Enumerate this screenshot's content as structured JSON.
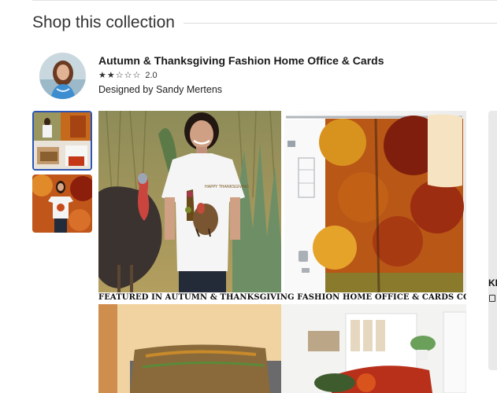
{
  "section": {
    "title": "Shop this collection"
  },
  "collection": {
    "title": "Autumn & Thanksgiving Fashion Home Office & Cards",
    "rating": {
      "stars_filled": 2,
      "stars_total": 5,
      "value": "2.0"
    },
    "designer_line": "Designed by Sandy Mertens"
  },
  "gallery": {
    "selected_index": 0,
    "hero_caption": "FEATURED IN AUTUMN & THANKSGIVING FASHION HOME OFFICE & CARDS COLLECTION",
    "tshirt_print_text": "HAPPY THANKSGIVING"
  },
  "next_card": {
    "label_fragment": "KI"
  },
  "colors": {
    "selected_border": "#2b55b5",
    "divider": "#dcdcdc",
    "text": "#212121"
  }
}
